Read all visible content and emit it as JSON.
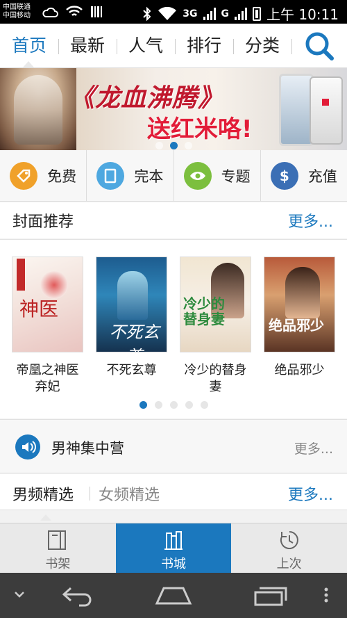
{
  "status_bar": {
    "carrier_1": "中国联通",
    "carrier_2": "中国移动",
    "network_1": "3G",
    "network_2": "G",
    "time": "上午 10:11"
  },
  "nav": {
    "tabs": [
      "首页",
      "最新",
      "人气",
      "排行",
      "分类"
    ],
    "active_index": 0,
    "accent_color": "#1b78be"
  },
  "banner": {
    "title": "《龙血沸腾》",
    "subtitle": "送红米咯!",
    "active_dot": 2,
    "dot_count": 3
  },
  "quick": [
    {
      "label": "免费",
      "icon": "tag-icon",
      "color": "#f0a12a"
    },
    {
      "label": "完本",
      "icon": "book-icon",
      "color": "#4ea8e0"
    },
    {
      "label": "专题",
      "icon": "eye-icon",
      "color": "#7cbf3e"
    },
    {
      "label": "充值",
      "icon": "dollar-icon",
      "color": "#3b6fb5"
    }
  ],
  "cover_section": {
    "title": "封面推荐",
    "more": "更多...",
    "books": [
      {
        "title": "帝凰之神医\n弃妃"
      },
      {
        "title": "不死玄尊"
      },
      {
        "title": "冷少的替身\n妻"
      },
      {
        "title": "绝品邪少"
      }
    ],
    "page_count": 5,
    "active_page": 0
  },
  "spotlight": {
    "title": "男神集中营",
    "more": "更多..."
  },
  "gender_tabs": {
    "male": "男频精选",
    "female": "女频精选",
    "more": "更多..."
  },
  "tabbar": {
    "items": [
      "书架",
      "书城",
      "上次"
    ],
    "active_index": 1
  }
}
